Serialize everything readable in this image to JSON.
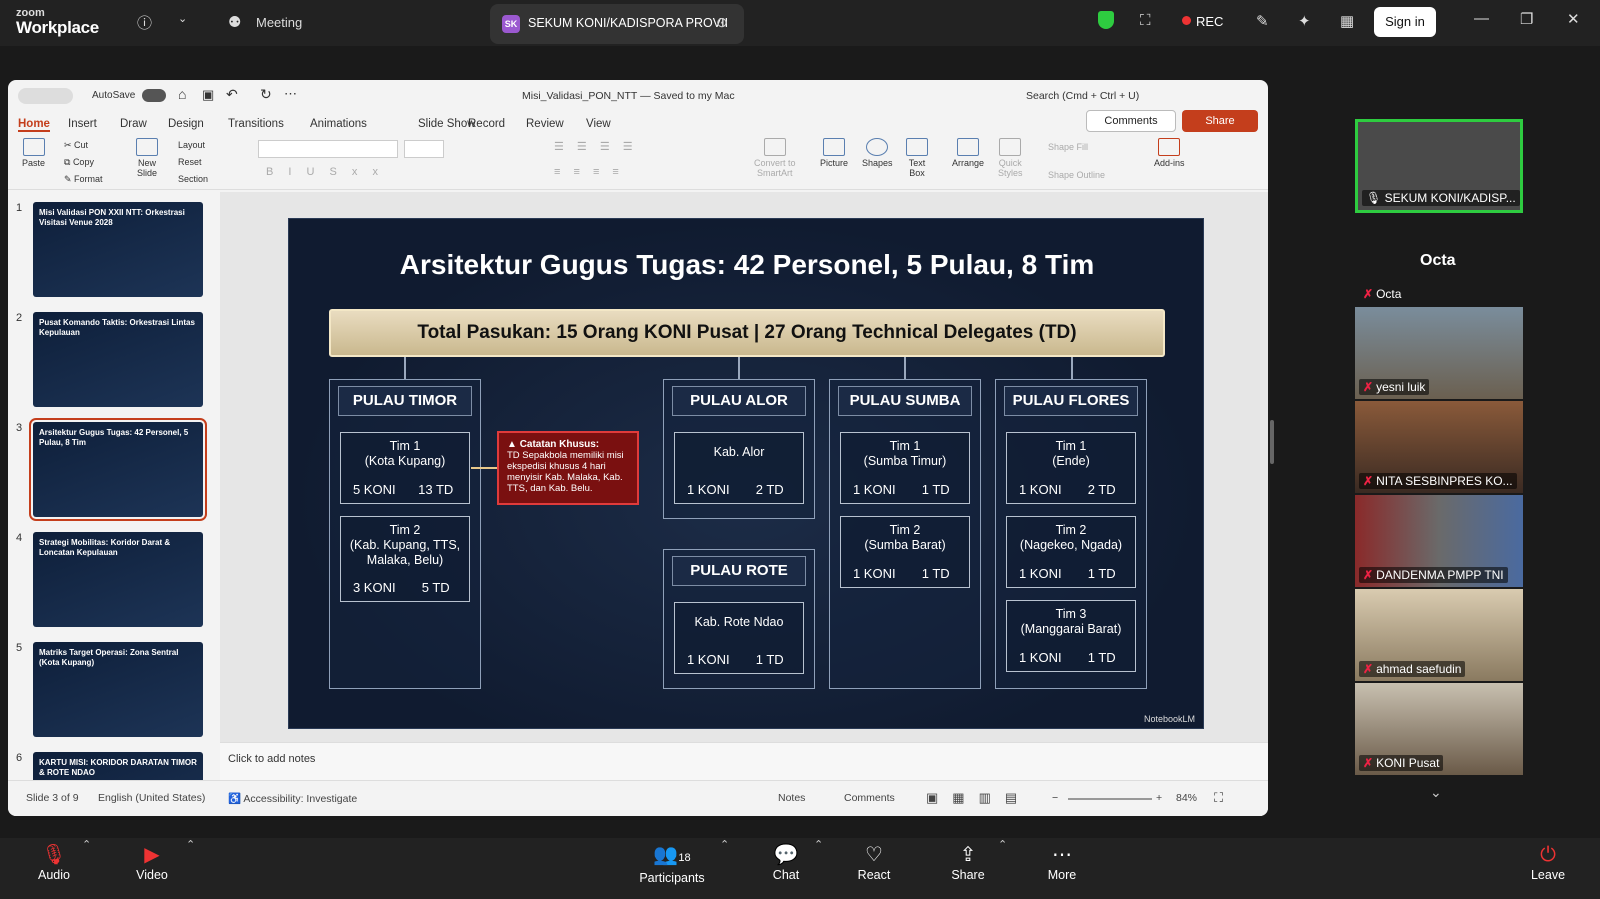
{
  "zoom": {
    "brand_small": "zoom",
    "brand": "Workplace",
    "meeting_label": "Meeting",
    "tab_initials": "SK",
    "tab_title": "SEKUM KONI/KADISPORA PROVII",
    "rec": "REC",
    "signin": "Sign in"
  },
  "ppt": {
    "autosave": "AutoSave",
    "file_title": "Misi_Validasi_PON_NTT — Saved to my Mac",
    "search": "Search (Cmd + Ctrl + U)",
    "comments_btn": "Comments",
    "share_btn": "Share",
    "tabs": [
      "Home",
      "Insert",
      "Draw",
      "Design",
      "Transitions",
      "Animations",
      "Slide Show",
      "Record",
      "Review",
      "View"
    ],
    "ribbon": {
      "paste": "Paste",
      "cut": "Cut",
      "copy": "Copy",
      "format": "Format",
      "new_slide": "New\nSlide",
      "layout": "Layout",
      "reset": "Reset",
      "section": "Section",
      "convert": "Convert to\nSmartArt",
      "picture": "Picture",
      "shapes": "Shapes",
      "textbox": "Text\nBox",
      "arrange": "Arrange",
      "quick_styles": "Quick\nStyles",
      "shape_fill": "Shape Fill",
      "shape_outline": "Shape Outline",
      "addins": "Add-ins"
    },
    "thumbs": [
      {
        "n": "1",
        "t": "Misi Validasi PON XXII NTT: Orkestrasi Visitasi Venue 2028"
      },
      {
        "n": "2",
        "t": "Pusat Komando Taktis: Orkestrasi Lintas Kepulauan"
      },
      {
        "n": "3",
        "t": "Arsitektur Gugus Tugas: 42 Personel, 5 Pulau, 8 Tim"
      },
      {
        "n": "4",
        "t": "Strategi Mobilitas: Koridor Darat & Loncatan Kepulauan"
      },
      {
        "n": "5",
        "t": "Matriks Target Operasi: Zona Sentral (Kota Kupang)"
      },
      {
        "n": "6",
        "t": "KARTU MISI: KORIDOR DARATAN TIMOR & ROTE NDAO"
      }
    ],
    "notes": "Click to add notes",
    "status": {
      "slide": "Slide 3 of 9",
      "lang": "English (United States)",
      "access": "Accessibility: Investigate",
      "notes": "Notes",
      "comments": "Comments",
      "zoom": "84%"
    }
  },
  "slide": {
    "title": "Arsitektur Gugus Tugas: 42 Personel, 5 Pulau, 8 Tim",
    "banner": "Total Pasukan: 15 Orang KONI Pusat | 27 Orang Technical Delegates (TD)",
    "timor": {
      "h": "PULAU TIMOR",
      "t1n": "Tim 1",
      "t1s": "(Kota Kupang)",
      "t1a": "5 KONI",
      "t1b": "13 TD",
      "t2n": "Tim 2",
      "t2s": "(Kab. Kupang, TTS, Malaka, Belu)",
      "t2a": "3 KONI",
      "t2b": "5 TD"
    },
    "catatan": {
      "h": "Catatan Khusus:",
      "b": "TD Sepakbola memiliki misi ekspedisi khusus 4 hari menyisir Kab. Malaka, Kab. TTS, dan Kab. Belu."
    },
    "alor": {
      "h": "PULAU ALOR",
      "t1": "Kab. Alor",
      "a": "1 KONI",
      "b": "2 TD"
    },
    "rote": {
      "h": "PULAU ROTE",
      "t1": "Kab. Rote Ndao",
      "a": "1 KONI",
      "b": "1 TD"
    },
    "sumba": {
      "h": "PULAU SUMBA",
      "t1n": "Tim 1",
      "t1s": "(Sumba Timur)",
      "t2n": "Tim 2",
      "t2s": "(Sumba Barat)",
      "a": "1 KONI",
      "b": "1 TD"
    },
    "flores": {
      "h": "PULAU FLORES",
      "t1n": "Tim 1",
      "t1s": "(Ende)",
      "t1a": "1 KONI",
      "t1b": "2 TD",
      "t2n": "Tim 2",
      "t2s": "(Nagekeo, Ngada)",
      "t3n": "Tim 3",
      "t3s": "(Manggarai Barat)",
      "a": "1 KONI",
      "b": "1 TD"
    },
    "watermark": "NotebookLM"
  },
  "participants": {
    "active": "SEKUM KONI/KADISP...",
    "heading": "Octa",
    "octa": "Octa",
    "list": [
      "yesni luik",
      "NITA SESBINPRES KO...",
      "DANDENMA PMPP TNI",
      "ahmad saefudin",
      "KONI Pusat"
    ]
  },
  "bottom": {
    "audio": "Audio",
    "video": "Video",
    "participants": "Participants",
    "count": "18",
    "chat": "Chat",
    "react": "React",
    "share": "Share",
    "more": "More",
    "leave": "Leave"
  }
}
